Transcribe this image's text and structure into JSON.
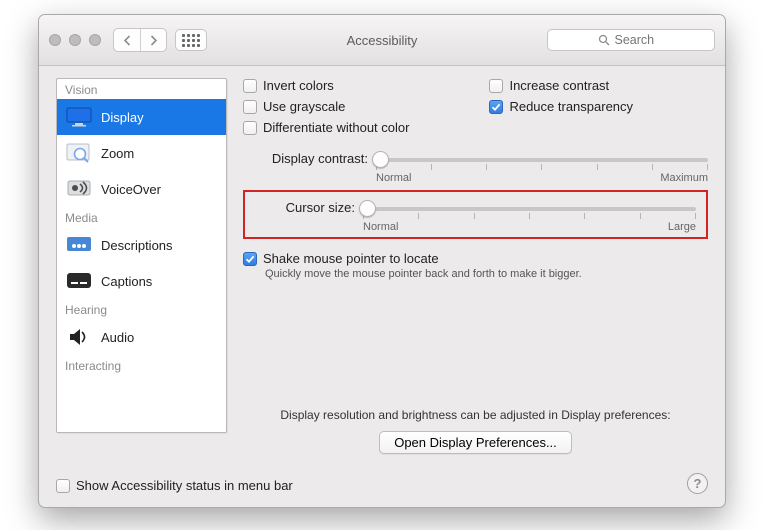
{
  "window": {
    "title": "Accessibility",
    "search_placeholder": "Search"
  },
  "sidebar": {
    "groups": [
      {
        "label": "Vision",
        "items": [
          {
            "key": "display",
            "label": "Display",
            "selected": true
          },
          {
            "key": "zoom",
            "label": "Zoom",
            "selected": false
          },
          {
            "key": "voiceover",
            "label": "VoiceOver",
            "selected": false
          }
        ]
      },
      {
        "label": "Media",
        "items": [
          {
            "key": "descriptions",
            "label": "Descriptions",
            "selected": false
          },
          {
            "key": "captions",
            "label": "Captions",
            "selected": false
          }
        ]
      },
      {
        "label": "Hearing",
        "items": [
          {
            "key": "audio",
            "label": "Audio",
            "selected": false
          }
        ]
      },
      {
        "label": "Interacting",
        "items": []
      }
    ]
  },
  "options": {
    "invert_colors": {
      "label": "Invert colors",
      "checked": false
    },
    "use_grayscale": {
      "label": "Use grayscale",
      "checked": false
    },
    "differentiate": {
      "label": "Differentiate without color",
      "checked": false
    },
    "increase_contrast": {
      "label": "Increase contrast",
      "checked": false
    },
    "reduce_transparency": {
      "label": "Reduce transparency",
      "checked": true
    }
  },
  "sliders": {
    "contrast": {
      "label": "Display contrast:",
      "min_label": "Normal",
      "max_label": "Maximum",
      "value_pct": 0
    },
    "cursor": {
      "label": "Cursor size:",
      "min_label": "Normal",
      "max_label": "Large",
      "value_pct": 0
    }
  },
  "shake": {
    "label": "Shake mouse pointer to locate",
    "checked": true,
    "desc": "Quickly move the mouse pointer back and forth to make it bigger."
  },
  "footer": {
    "msg": "Display resolution and brightness can be adjusted in Display preferences:",
    "button": "Open Display Preferences..."
  },
  "menubar": {
    "label": "Show Accessibility status in menu bar",
    "checked": false
  },
  "help": "?"
}
